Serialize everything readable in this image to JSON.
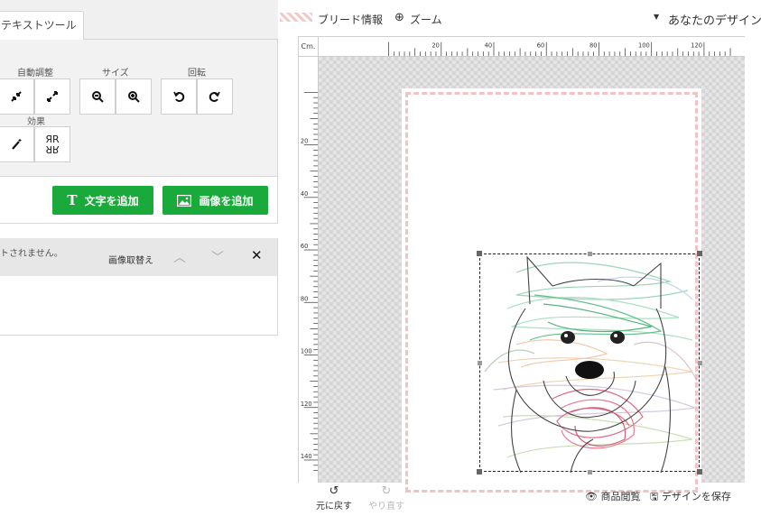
{
  "tabs": {
    "text_tool": "テキストツール"
  },
  "tools": {
    "auto_adjust_label": "自動調整",
    "size_label": "サイズ",
    "rotate_label": "回転",
    "effects_label": "効果",
    "flip_glyph": "ЯR"
  },
  "add_buttons": {
    "text_icon": "T",
    "add_text": "文字を追加",
    "add_image": "画像を追加",
    "accent_color": "#1aaa3c"
  },
  "layer": {
    "message": "トされません。",
    "swap_image": "画像取替え",
    "up": "︿",
    "down": "﹀",
    "close": "✕"
  },
  "top_bar": {
    "bleed_info": "ブリード情報",
    "zoom": "ズーム",
    "your_design": "あなたのデザイン"
  },
  "ruler": {
    "unit": "Cm.",
    "h_labels": [
      "20",
      "40",
      "60",
      "80",
      "100",
      "120"
    ],
    "v_labels": [
      "20",
      "40",
      "60",
      "80",
      "100",
      "120",
      "140"
    ]
  },
  "bottom": {
    "undo": "元に戻す",
    "redo": "やり直す",
    "preview": "商品閲覧",
    "save": "デザインを保存"
  }
}
